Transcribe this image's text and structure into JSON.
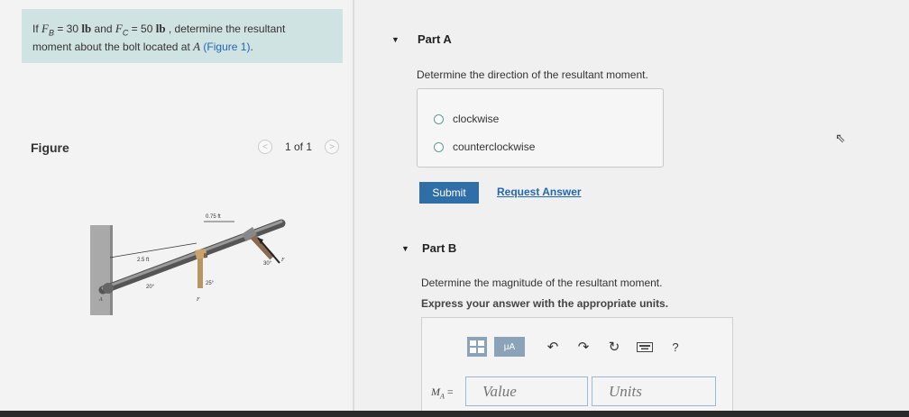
{
  "problem": {
    "prefix": "If ",
    "fb_var": "F",
    "fb_sub": "B",
    "fb_eq": " = 30 ",
    "fb_unit": "lb",
    "and": " and ",
    "fc_var": "F",
    "fc_sub": "C",
    "fc_eq": " = 50 ",
    "fc_unit": "lb",
    "line1_end": " , determine the resultant",
    "line2_start": "moment about the bolt located at ",
    "point": "A",
    "figure_ref": "(Figure 1)",
    "period": "."
  },
  "figure": {
    "label": "Figure",
    "pager_prev": "<",
    "pager_count": "1 of 1",
    "pager_next": ">",
    "dim_top": "0.75 ft",
    "dim_left": "2.5 ft",
    "angle_bottom": "20°",
    "angle_b": "25°",
    "angle_c": "30°",
    "label_b": "B",
    "label_fb": "F",
    "label_fc": "F",
    "label_a": "A"
  },
  "partA": {
    "title": "Part A",
    "question": "Determine the direction of the resultant moment.",
    "options": [
      "clockwise",
      "counterclockwise"
    ],
    "submit": "Submit",
    "request": "Request Answer"
  },
  "partB": {
    "title": "Part B",
    "question": "Determine the magnitude of the resultant moment.",
    "instruction": "Express your answer with the appropriate units.",
    "toolbar": {
      "units_icon_label": "μA",
      "help": "?"
    },
    "m_label_var": "M",
    "m_label_sub": "A",
    "m_label_eq": " =",
    "value_placeholder": "Value",
    "units_placeholder": "Units"
  }
}
